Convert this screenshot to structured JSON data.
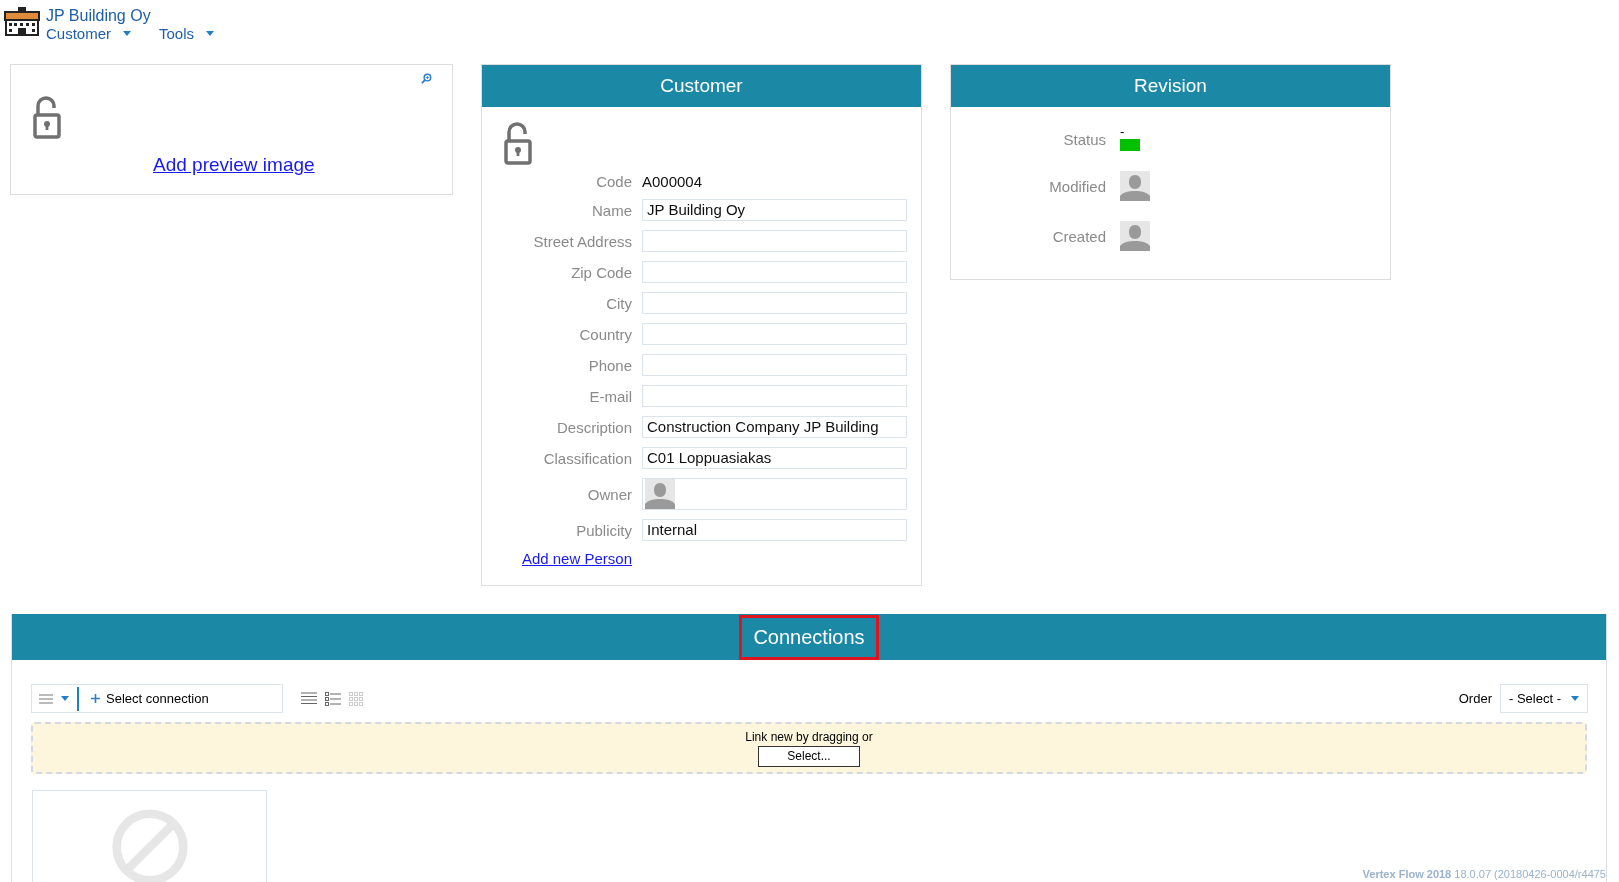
{
  "header": {
    "title": "JP Building Oy",
    "menus": [
      {
        "label": "Customer"
      },
      {
        "label": "Tools"
      }
    ]
  },
  "preview": {
    "link": "Add preview image"
  },
  "customer": {
    "title": "Customer",
    "fields": [
      {
        "label": "Code",
        "kind": "text",
        "value": "A000004"
      },
      {
        "label": "Name",
        "kind": "input",
        "value": "JP Building Oy"
      },
      {
        "label": "Street Address",
        "kind": "input"
      },
      {
        "label": "Zip Code",
        "kind": "input"
      },
      {
        "label": "City",
        "kind": "input"
      },
      {
        "label": "Country",
        "kind": "input"
      },
      {
        "label": "Phone",
        "kind": "input"
      },
      {
        "label": "E-mail",
        "kind": "input"
      },
      {
        "label": "Description",
        "kind": "input",
        "value": "Construction Company JP Building"
      },
      {
        "label": "Classification",
        "kind": "input",
        "value": "C01 Loppuasiakas"
      },
      {
        "label": "Owner",
        "kind": "person"
      },
      {
        "label": "Publicity",
        "kind": "input",
        "value": "Internal"
      }
    ],
    "link": "Add new Person"
  },
  "revision": {
    "title": "Revision",
    "rows": [
      {
        "label": "Status",
        "kind": "status",
        "value": "-",
        "color": "#00c000"
      },
      {
        "label": "Modified",
        "kind": "person"
      },
      {
        "label": "Created",
        "kind": "person"
      }
    ]
  },
  "connections": {
    "title": "Connections",
    "highlighted": true,
    "select_button": "Select connection",
    "order_label": "Order",
    "order_value": "- Select -",
    "drop_text": "Link new by dragging or",
    "drop_button": "Select..."
  },
  "footer": {
    "product": "Vertex Flow 2018",
    "version": "18.0.07 (20180426-0004/r4475"
  }
}
